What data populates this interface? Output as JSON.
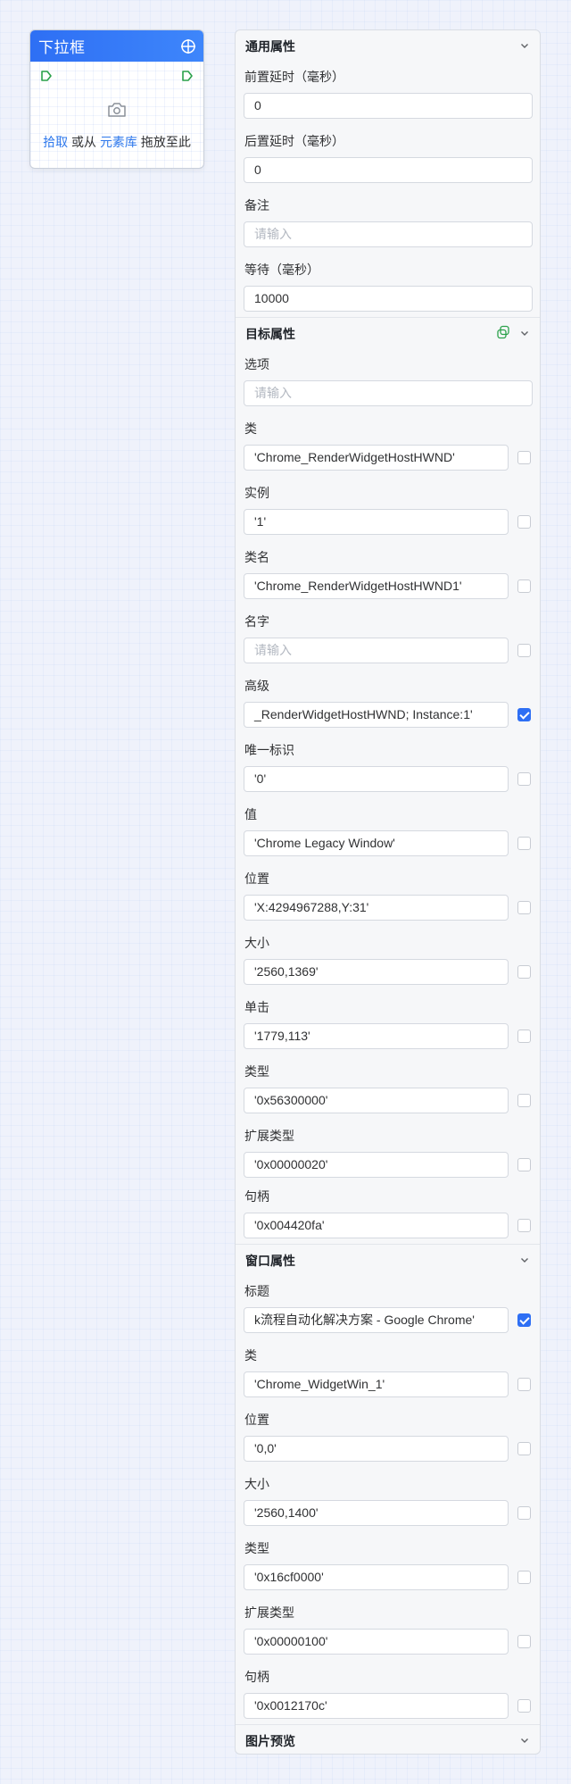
{
  "node": {
    "title": "下拉框",
    "pick_label": "拾取",
    "or_label": "或从",
    "library_label": "元素库",
    "drag_label": "拖放至此"
  },
  "general": {
    "title": "通用属性",
    "fields": [
      {
        "label": "前置延时（毫秒）",
        "value": "0",
        "placeholder": ""
      },
      {
        "label": "后置延时（毫秒）",
        "value": "0",
        "placeholder": ""
      },
      {
        "label": "备注",
        "value": "",
        "placeholder": "请输入"
      },
      {
        "label": "等待（毫秒）",
        "value": "10000",
        "placeholder": ""
      }
    ]
  },
  "target": {
    "title": "目标属性",
    "option_label": "选项",
    "option_placeholder": "请输入",
    "fields": [
      {
        "label": "类",
        "value": "'Chrome_RenderWidgetHostHWND'",
        "checked": false
      },
      {
        "label": "实例",
        "value": "'1'",
        "checked": false
      },
      {
        "label": "类名",
        "value": "'Chrome_RenderWidgetHostHWND1'",
        "checked": false
      },
      {
        "label": "名字",
        "value": "",
        "placeholder": "请输入",
        "checked": false
      },
      {
        "label": "高级",
        "value": "_RenderWidgetHostHWND; Instance:1'",
        "checked": true
      },
      {
        "label": "唯一标识",
        "value": "'0'",
        "checked": false
      },
      {
        "label": "值",
        "value": "'Chrome Legacy Window'",
        "checked": false
      },
      {
        "label": "位置",
        "value": "'X:4294967288,Y:31'",
        "checked": false
      },
      {
        "label": "大小",
        "value": "'2560,1369'",
        "checked": false
      },
      {
        "label": "单击",
        "value": "'1779,113'",
        "checked": false
      },
      {
        "label": "类型",
        "value": "'0x56300000'",
        "checked": false
      },
      {
        "label": "扩展类型",
        "value": "'0x00000020'",
        "checked": false
      },
      {
        "label": "句柄",
        "value": "'0x004420fa'",
        "checked": false
      }
    ]
  },
  "window": {
    "title": "窗口属性",
    "fields": [
      {
        "label": "标题",
        "value": "k流程自动化解决方案 - Google Chrome'",
        "checked": true
      },
      {
        "label": "类",
        "value": "'Chrome_WidgetWin_1'",
        "checked": false
      },
      {
        "label": "位置",
        "value": "'0,0'",
        "checked": false
      },
      {
        "label": "大小",
        "value": "'2560,1400'",
        "checked": false
      },
      {
        "label": "类型",
        "value": "'0x16cf0000'",
        "checked": false
      },
      {
        "label": "扩展类型",
        "value": "'0x00000100'",
        "checked": false
      },
      {
        "label": "句柄",
        "value": "'0x0012170c'",
        "checked": false
      }
    ]
  },
  "preview": {
    "title": "图片预览"
  },
  "colors": {
    "accent": "#2e6ff4",
    "link": "#2e78ec"
  }
}
